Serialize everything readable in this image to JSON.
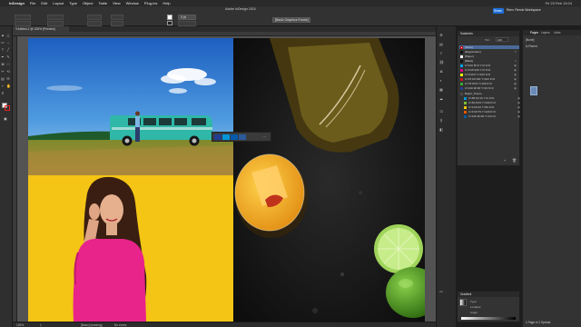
{
  "menubar": {
    "app": "InDesign",
    "items": [
      "File",
      "Edit",
      "Layout",
      "Type",
      "Object",
      "Table",
      "View",
      "Window",
      "Plug-ins",
      "Help"
    ],
    "clock": "Fri 23 Feb 13:24"
  },
  "control": {
    "window_title": "Adobe InDesign 2024",
    "style_selector": "[Basic Graphics Frame]",
    "workspace_button": "Share",
    "workspace": "Rem: Remix Workspace",
    "stroke_weight": "0 pt"
  },
  "document": {
    "tab_title": "*Untitled-1 @ 126% (Preview)"
  },
  "swatches": {
    "title": "Swatches",
    "tint_label": "Tint:",
    "tint_value": "100",
    "items": [
      {
        "name": "[None]",
        "color": "#ffffff"
      },
      {
        "name": "[Registration]",
        "color": "#111111"
      },
      {
        "name": "[Paper]",
        "color": "#ffffff"
      },
      {
        "name": "[Black]",
        "color": "#111111"
      },
      {
        "name": "C=100 M=0 Y=0 K=0",
        "color": "#00a0e9"
      },
      {
        "name": "C=0 M=100 Y=0 K=0",
        "color": "#e4007f"
      },
      {
        "name": "C=0 M=0 Y=100 K=0",
        "color": "#fff100"
      },
      {
        "name": "C=15 M=100 Y=100 K=0",
        "color": "#c8161d"
      },
      {
        "name": "C=75 M=5 Y=100 K=0",
        "color": "#3aa935"
      },
      {
        "name": "C=100 M=90 Y=10 K=0",
        "color": "#233f92"
      },
      {
        "name": "Bright_Theme",
        "color": "#4a4a4a"
      },
      {
        "name": "C=85 M=10 Y=0 K=0",
        "color": "#0097d8"
      },
      {
        "name": "C=60 M=0 Y=100 K=0",
        "color": "#7cbe31"
      },
      {
        "name": "C=0 M=22 Y=95 K=0",
        "color": "#fcc800"
      },
      {
        "name": "C=0 M=79 Y=100 K=0",
        "color": "#ea5504"
      },
      {
        "name": "C=100 M=60 Y=0 K=0",
        "color": "#005bac"
      }
    ]
  },
  "gradient": {
    "title": "Gradient",
    "type_label": "Type:",
    "location_label": "Location:",
    "angle_label": "Angle:"
  },
  "pages": {
    "tabs": [
      "Pages",
      "Layers",
      "Links"
    ],
    "none_label": "[None]",
    "master_label": "A-Parent",
    "footer": "1 Page in 1 Spread"
  },
  "statusbar": {
    "zoom": "126%",
    "page": "1",
    "preflight": "[Basic] (working)",
    "errors": "No errors"
  },
  "colors": {
    "accent": "#1e6fd9",
    "van": "#2fb7a8",
    "yellow_bg": "#f4c515",
    "shirt": "#e8238a"
  }
}
